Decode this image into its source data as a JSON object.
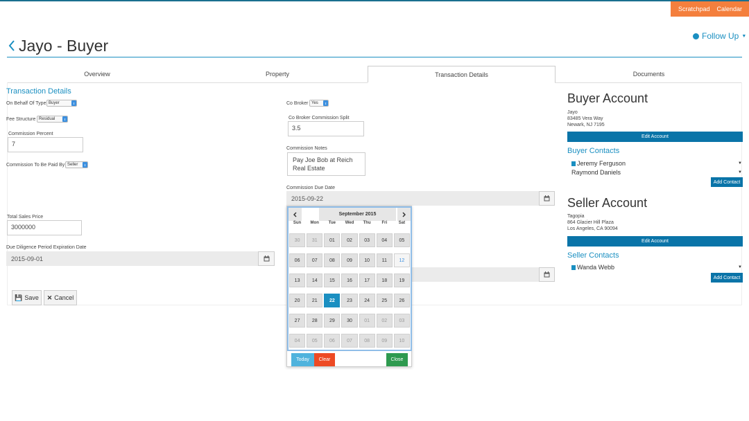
{
  "header": {
    "scratchpad": "Scratchpad",
    "calendar": "Calendar",
    "follow_up": "Follow Up",
    "title": "Jayo - Buyer"
  },
  "tabs": [
    "Overview",
    "Property",
    "Transaction Details",
    "Documents"
  ],
  "colors": {
    "accent": "#1a8fc1",
    "orange": "#f47f3d",
    "dark_blue": "#0a74a8",
    "today_btn": "#4fb3dd",
    "clear_btn": "#ed4a24",
    "close_btn": "#2e9a4f"
  },
  "form": {
    "section_title": "Transaction Details",
    "on_behalf_label": "On Behalf Of Type",
    "on_behalf_value": "Buyer",
    "fee_structure_label": "Fee Structure",
    "fee_structure_value": "Residual",
    "commission_percent_label": "Commission Percent",
    "commission_percent_value": "7",
    "paid_by_label": "Commission To Be Paid By",
    "paid_by_value": "Seller",
    "total_sales_label": "Total Sales Price",
    "total_sales_value": "3000000",
    "due_diligence_label": "Due Diligence Period Expiration Date",
    "due_diligence_value": "2015-09-01",
    "co_broker_label": "Co Broker",
    "co_broker_value": "Yes",
    "co_broker_split_label": "Co Broker Commission Split",
    "co_broker_split_value": "3.5",
    "notes_label": "Commission Notes",
    "notes_value": "Pay Joe Bob at Reich Real Estate",
    "due_date_label": "Commission Due Date",
    "due_date_value": "2015-09-22",
    "save_label": "Save",
    "cancel_label": "Cancel"
  },
  "buyer": {
    "title": "Buyer Account",
    "name": "Jayo",
    "street": "83485 Vera Way",
    "city": "Newark, NJ 7195",
    "edit_label": "Edit Account",
    "contacts_title": "Buyer Contacts",
    "contacts": [
      "Jeremy Ferguson",
      "Raymond Daniels"
    ],
    "add_label": "Add Contact"
  },
  "seller": {
    "title": "Seller Account",
    "name": "Tagopia",
    "street": "864 Glacier Hill Plaza",
    "city": "Los Angeles, CA 90094",
    "edit_label": "Edit Account",
    "contacts_title": "Seller Contacts",
    "contacts": [
      "Wanda Webb"
    ],
    "add_label": "Add Contact"
  },
  "datepicker": {
    "month_label": "September 2015",
    "weekdays": [
      "Sun",
      "Mon",
      "Tue",
      "Wed",
      "Thu",
      "Fri",
      "Sat"
    ],
    "days": [
      {
        "d": "30",
        "s": "mute"
      },
      {
        "d": "31",
        "s": "mute"
      },
      {
        "d": "01"
      },
      {
        "d": "02"
      },
      {
        "d": "03"
      },
      {
        "d": "04"
      },
      {
        "d": "05"
      },
      {
        "d": "06"
      },
      {
        "d": "07"
      },
      {
        "d": "08"
      },
      {
        "d": "09"
      },
      {
        "d": "10"
      },
      {
        "d": "11"
      },
      {
        "d": "12",
        "s": "today"
      },
      {
        "d": "13"
      },
      {
        "d": "14"
      },
      {
        "d": "15"
      },
      {
        "d": "16"
      },
      {
        "d": "17"
      },
      {
        "d": "18"
      },
      {
        "d": "19"
      },
      {
        "d": "20"
      },
      {
        "d": "21"
      },
      {
        "d": "22",
        "s": "act"
      },
      {
        "d": "23"
      },
      {
        "d": "24"
      },
      {
        "d": "25"
      },
      {
        "d": "26"
      },
      {
        "d": "27"
      },
      {
        "d": "28"
      },
      {
        "d": "29"
      },
      {
        "d": "30"
      },
      {
        "d": "01",
        "s": "mute"
      },
      {
        "d": "02",
        "s": "mute"
      },
      {
        "d": "03",
        "s": "mute"
      },
      {
        "d": "04",
        "s": "mute"
      },
      {
        "d": "05",
        "s": "mute"
      },
      {
        "d": "06",
        "s": "mute"
      },
      {
        "d": "07",
        "s": "mute"
      },
      {
        "d": "08",
        "s": "mute"
      },
      {
        "d": "09",
        "s": "mute"
      },
      {
        "d": "10",
        "s": "mute"
      }
    ],
    "today_label": "Today",
    "clear_label": "Clear",
    "close_label": "Close"
  }
}
